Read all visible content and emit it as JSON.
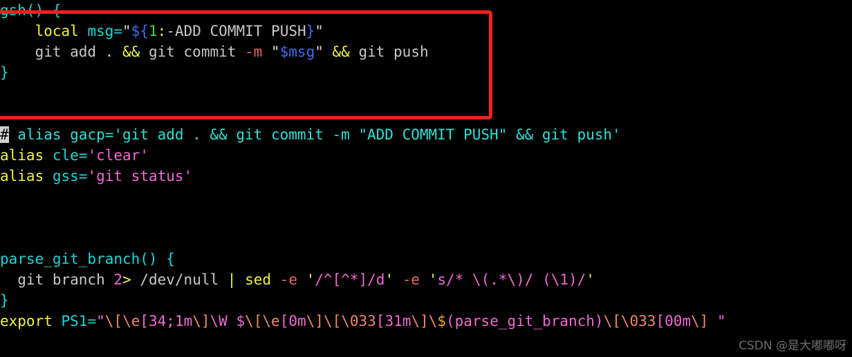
{
  "window": {
    "kind": "terminal-text-editor",
    "background_color": "#000000",
    "default_text_color": "#c8c8c8"
  },
  "annotation": {
    "shape": "rectangle",
    "color": "#fb1f1f",
    "covers": "gsh-function-block"
  },
  "cursor": {
    "character": "#",
    "background_color": "#d0d0d0",
    "text_color": "#000000",
    "on_line": 7
  },
  "watermark": {
    "text": "CSDN @是大嘟嘟呀",
    "color": "#6e6e6e"
  },
  "colors": {
    "function": "#1fd6d6",
    "keyword": "#f2f242",
    "plain": "#c8c8c8",
    "flag": "#e8685f",
    "expansion": "#4169f0",
    "number": "#42d742",
    "comment": "#2ce0d8",
    "single_quoted": "#f06ad2",
    "escape": "#f08a6a",
    "annotation": "#fb1f1f"
  },
  "code": {
    "raw_text": "gsh() {\n    local msg=\"${1:-ADD COMMIT PUSH}\"\n    git add . && git commit -m \"$msg\" && git push\n}\n\n# alias gacp='git add . && git commit -m \"ADD COMMIT PUSH\" && git push'\nalias cle='clear'\nalias gss='git status'\n\n\nparse_git_branch() {\n  git branch 2> /dev/null | sed -e '/^[^*]/d' -e 's/* \\(.*\\)/ (\\1)/'\n}\nexport PS1=\"\\[\\e[34;1m\\]\\W $\\[\\e[0m\\]\\[\\033[31m\\]\\$(parse_git_branch)\\[\\033[00m\\] \"",
    "lines": [
      {
        "n": 1,
        "text": "gsh() {",
        "tokens": [
          {
            "t": "gsh() {",
            "c": "fn"
          }
        ]
      },
      {
        "n": 2,
        "text": "    local msg=\"${1:-ADD COMMIT PUSH}\"",
        "tokens": [
          {
            "t": "    ",
            "c": "plain"
          },
          {
            "t": "local",
            "c": "kw"
          },
          {
            "t": " ",
            "c": "plain"
          },
          {
            "t": "msg",
            "c": "var"
          },
          {
            "t": "=",
            "c": "op"
          },
          {
            "t": "\"",
            "c": "quote"
          },
          {
            "t": "$",
            "c": "dollar"
          },
          {
            "t": "{",
            "c": "dollar"
          },
          {
            "t": "1",
            "c": "num"
          },
          {
            "t": ":",
            "c": "colon"
          },
          {
            "t": "-ADD COMMIT PUSH",
            "c": "plain"
          },
          {
            "t": "}",
            "c": "dollar"
          },
          {
            "t": "\"",
            "c": "quote"
          }
        ]
      },
      {
        "n": 3,
        "text": "    git add . && git commit -m \"$msg\" && git push",
        "tokens": [
          {
            "t": "    git add . ",
            "c": "plain"
          },
          {
            "t": "&&",
            "c": "kw"
          },
          {
            "t": " git commit ",
            "c": "plain"
          },
          {
            "t": "-m",
            "c": "param"
          },
          {
            "t": " ",
            "c": "plain"
          },
          {
            "t": "\"",
            "c": "quote"
          },
          {
            "t": "$msg",
            "c": "dollar"
          },
          {
            "t": "\"",
            "c": "quote"
          },
          {
            "t": " ",
            "c": "plain"
          },
          {
            "t": "&&",
            "c": "kw"
          },
          {
            "t": " git push",
            "c": "plain"
          }
        ]
      },
      {
        "n": 4,
        "text": "}",
        "tokens": [
          {
            "t": "}",
            "c": "fn"
          }
        ]
      },
      {
        "n": 5,
        "text": "",
        "tokens": []
      },
      {
        "n": 6,
        "text": "",
        "tokens": []
      },
      {
        "n": 7,
        "text": "# alias gacp='git add . && git commit -m \"ADD COMMIT PUSH\" && git push'",
        "tokens": [
          {
            "t": "#",
            "c": "cursor"
          },
          {
            "t": " alias gacp='git add . && git commit -m \"ADD COMMIT PUSH\" && git push'",
            "c": "comment"
          }
        ]
      },
      {
        "n": 8,
        "text": "alias cle='clear'",
        "tokens": [
          {
            "t": "alias",
            "c": "kw"
          },
          {
            "t": " ",
            "c": "plain"
          },
          {
            "t": "cle",
            "c": "var"
          },
          {
            "t": "=",
            "c": "op"
          },
          {
            "t": "'clear'",
            "c": "sq"
          }
        ]
      },
      {
        "n": 9,
        "text": "alias gss='git status'",
        "tokens": [
          {
            "t": "alias",
            "c": "kw"
          },
          {
            "t": " ",
            "c": "plain"
          },
          {
            "t": "gss",
            "c": "var"
          },
          {
            "t": "=",
            "c": "op"
          },
          {
            "t": "'git status'",
            "c": "sq"
          }
        ]
      },
      {
        "n": 10,
        "text": "",
        "tokens": []
      },
      {
        "n": 11,
        "text": "",
        "tokens": []
      },
      {
        "n": 12,
        "text": "",
        "tokens": []
      },
      {
        "n": 13,
        "text": "parse_git_branch() {",
        "tokens": [
          {
            "t": "parse_git_branch() {",
            "c": "fn"
          }
        ]
      },
      {
        "n": 14,
        "text": "  git branch 2> /dev/null | sed -e '/^[^*]/d' -e 's/* \\(.*\\)/ (\\1)/'",
        "tokens": [
          {
            "t": "  git branch ",
            "c": "plain"
          },
          {
            "t": "2",
            "c": "magenta"
          },
          {
            "t": ">",
            "c": "redir"
          },
          {
            "t": " /dev/null ",
            "c": "plain"
          },
          {
            "t": "|",
            "c": "redir"
          },
          {
            "t": " ",
            "c": "plain"
          },
          {
            "t": "sed",
            "c": "kw"
          },
          {
            "t": " ",
            "c": "plain"
          },
          {
            "t": "-e",
            "c": "param"
          },
          {
            "t": " ",
            "c": "plain"
          },
          {
            "t": "'",
            "c": "sqy"
          },
          {
            "t": "/^[^*]/d",
            "c": "sq"
          },
          {
            "t": "'",
            "c": "sqy"
          },
          {
            "t": " ",
            "c": "plain"
          },
          {
            "t": "-e",
            "c": "param"
          },
          {
            "t": " ",
            "c": "plain"
          },
          {
            "t": "'",
            "c": "sqy"
          },
          {
            "t": "s/* \\(.*\\)/ (\\1)/",
            "c": "sq"
          },
          {
            "t": "'",
            "c": "sqy"
          }
        ]
      },
      {
        "n": 15,
        "text": "}",
        "tokens": [
          {
            "t": "}",
            "c": "fn"
          }
        ]
      },
      {
        "n": 16,
        "text": "export PS1=\"\\[\\e[34;1m\\]\\W $\\[\\e[0m\\]\\[\\033[31m\\]\\$(parse_git_branch)\\[\\033[00m\\] \"",
        "tokens": [
          {
            "t": "export",
            "c": "kw"
          },
          {
            "t": " ",
            "c": "plain"
          },
          {
            "t": "PS1",
            "c": "var"
          },
          {
            "t": "=",
            "c": "op"
          },
          {
            "t": "\"",
            "c": "magenta"
          },
          {
            "t": "\\[",
            "c": "esc"
          },
          {
            "t": "\\e",
            "c": "esc"
          },
          {
            "t": "[34;1m",
            "c": "magenta"
          },
          {
            "t": "\\]",
            "c": "esc"
          },
          {
            "t": "\\W $",
            "c": "magenta"
          },
          {
            "t": "\\[",
            "c": "esc"
          },
          {
            "t": "\\e",
            "c": "esc"
          },
          {
            "t": "[0m",
            "c": "magenta"
          },
          {
            "t": "\\]",
            "c": "esc"
          },
          {
            "t": "\\[",
            "c": "esc"
          },
          {
            "t": "\\033",
            "c": "esc"
          },
          {
            "t": "[31m",
            "c": "magenta"
          },
          {
            "t": "\\]",
            "c": "esc"
          },
          {
            "t": "\\",
            "c": "esc"
          },
          {
            "t": "$",
            "c": "orange"
          },
          {
            "t": "(parse_git_branch)",
            "c": "magenta"
          },
          {
            "t": "\\[",
            "c": "esc"
          },
          {
            "t": "\\033",
            "c": "esc"
          },
          {
            "t": "[00m",
            "c": "magenta"
          },
          {
            "t": "\\]",
            "c": "esc"
          },
          {
            "t": " ",
            "c": "magenta"
          },
          {
            "t": "\"",
            "c": "magenta"
          }
        ]
      }
    ]
  }
}
